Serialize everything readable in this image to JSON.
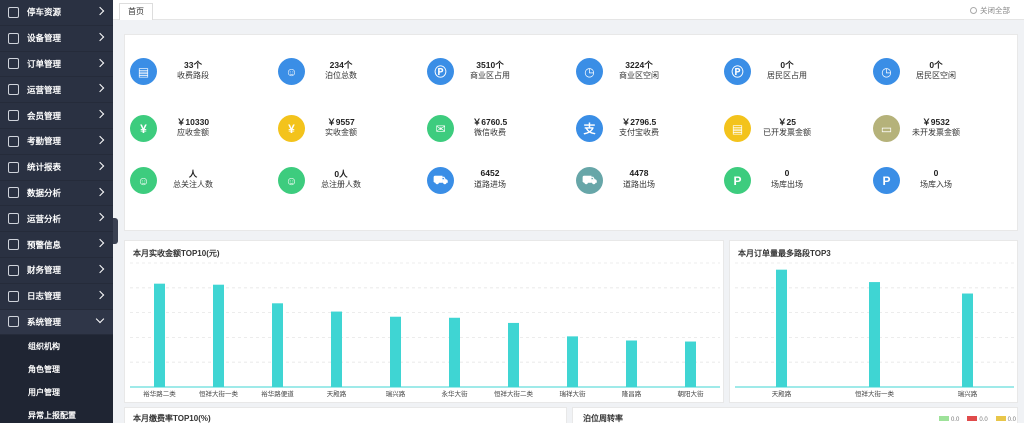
{
  "sidebar": {
    "items": [
      {
        "label": "停车资源",
        "icon": "parking-resource-icon",
        "open": false
      },
      {
        "label": "设备管理",
        "icon": "device-icon",
        "open": false
      },
      {
        "label": "订单管理",
        "icon": "order-icon",
        "open": false
      },
      {
        "label": "运营管理",
        "icon": "operation-icon",
        "open": false
      },
      {
        "label": "会员管理",
        "icon": "member-icon",
        "open": false
      },
      {
        "label": "考勤管理",
        "icon": "attendance-icon",
        "open": false
      },
      {
        "label": "统计报表",
        "icon": "report-icon",
        "open": false
      },
      {
        "label": "数据分析",
        "icon": "data-analysis-icon",
        "open": false
      },
      {
        "label": "运营分析",
        "icon": "operation-analysis-icon",
        "open": false
      },
      {
        "label": "预警信息",
        "icon": "alert-icon",
        "open": false
      },
      {
        "label": "财务管理",
        "icon": "finance-icon",
        "open": false
      },
      {
        "label": "日志管理",
        "icon": "log-icon",
        "open": false
      },
      {
        "label": "系统管理",
        "icon": "gear-icon",
        "open": true
      }
    ],
    "sub_items": [
      "组织机构",
      "角色管理",
      "用户管理",
      "异常上报配置"
    ]
  },
  "tabs": {
    "active": "首页",
    "close_all": "关闭全部"
  },
  "stats": [
    {
      "value": "33个",
      "label": "收费路段",
      "color": "#3a8ee6",
      "icon": "road-doc-icon",
      "glyph": "▤"
    },
    {
      "value": "234个",
      "label": "泊位总数",
      "color": "#3a8ee6",
      "icon": "person-icon",
      "glyph": "☺"
    },
    {
      "value": "3510个",
      "label": "商业区占用",
      "color": "#3a8ee6",
      "icon": "parking-p-icon",
      "glyph": "Ⓟ"
    },
    {
      "value": "3224个",
      "label": "商业区空闲",
      "color": "#3a8ee6",
      "icon": "clock-icon",
      "glyph": "◷"
    },
    {
      "value": "0个",
      "label": "居民区占用",
      "color": "#3a8ee6",
      "icon": "parking-p-icon",
      "glyph": "Ⓟ"
    },
    {
      "value": "0个",
      "label": "居民区空闲",
      "color": "#3a8ee6",
      "icon": "clock-icon",
      "glyph": "◷"
    },
    {
      "value": "￥10330",
      "label": "应收金额",
      "color": "#3dcc7e",
      "icon": "yen-icon",
      "glyph": "¥"
    },
    {
      "value": "￥9557",
      "label": "实收金额",
      "color": "#f3c31c",
      "icon": "yen-icon",
      "glyph": "¥"
    },
    {
      "value": "￥6760.5",
      "label": "微信收费",
      "color": "#3dcc7e",
      "icon": "wechat-icon",
      "glyph": "✉"
    },
    {
      "value": "￥2796.5",
      "label": "支付宝收费",
      "color": "#3a8ee6",
      "icon": "alipay-icon",
      "glyph": "支"
    },
    {
      "value": "￥25",
      "label": "已开发票金额",
      "color": "#f3c31c",
      "icon": "invoice-icon",
      "glyph": "▤"
    },
    {
      "value": "￥9532",
      "label": "未开发票金额",
      "color": "#b5b27a",
      "icon": "invoice-pending-icon",
      "glyph": "▭"
    },
    {
      "value": "人",
      "label": "总关注人数",
      "color": "#3dcc7e",
      "icon": "follow-icon",
      "glyph": "☺"
    },
    {
      "value": "0人",
      "label": "总注册人数",
      "color": "#3dcc7e",
      "icon": "register-icon",
      "glyph": "☺"
    },
    {
      "value": "6452",
      "label": "道路进场",
      "color": "#3a8ee6",
      "icon": "car-icon",
      "glyph": "⛟"
    },
    {
      "value": "4478",
      "label": "道路出场",
      "color": "#67a6a8",
      "icon": "car-icon",
      "glyph": "⛟"
    },
    {
      "value": "0",
      "label": "场库出场",
      "color": "#3dcc7e",
      "icon": "garage-exit-icon",
      "glyph": "P"
    },
    {
      "value": "0",
      "label": "场库入场",
      "color": "#3a8ee6",
      "icon": "garage-entry-icon",
      "glyph": "P"
    }
  ],
  "chart_data": [
    {
      "type": "bar",
      "title": "本月实收金额TOP10(元)",
      "categories": [
        "裕华路二类",
        "恒祥大街一类",
        "裕华路便道",
        "天殿路",
        "瑞兴路",
        "永华大街",
        "恒祥大街二类",
        "瑞祥大街",
        "隆昌路",
        "朝阳大街"
      ],
      "values": [
        100,
        99,
        81,
        73,
        68,
        67,
        62,
        49,
        45,
        44
      ],
      "ylim": [
        0,
        120
      ],
      "color": "#3fd5d3",
      "grid": true
    },
    {
      "type": "bar",
      "title": "本月订单量最多路段TOP3",
      "categories": [
        "天殿路",
        "恒祥大街一类",
        "瑞兴路"
      ],
      "values": [
        123,
        110,
        98
      ],
      "ylim": [
        0,
        130
      ],
      "color": "#3fd5d3",
      "grid": true
    }
  ],
  "bottom_panels": {
    "left_title": "本月缴费率TOP10(%)",
    "right_title": "泊位周转率"
  },
  "legend": [
    {
      "label": "0.0",
      "color": "#9ee29a"
    },
    {
      "label": "0.0",
      "color": "#e04b4b"
    },
    {
      "label": "0.0",
      "color": "#e8c64a"
    }
  ]
}
